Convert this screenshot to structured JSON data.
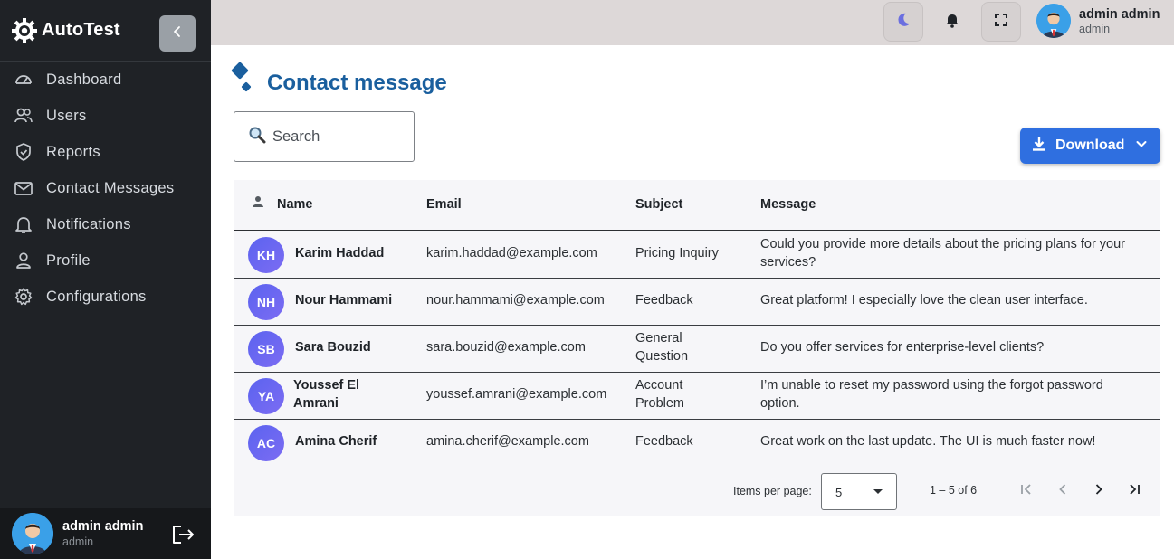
{
  "app": {
    "name": "AutoTest"
  },
  "sidebar": {
    "items": [
      {
        "label": "Dashboard",
        "icon": "dashboard-icon"
      },
      {
        "label": "Users",
        "icon": "users-icon"
      },
      {
        "label": "Reports",
        "icon": "shield-icon"
      },
      {
        "label": "Contact Messages",
        "icon": "mail-icon"
      },
      {
        "label": "Notifications",
        "icon": "bell-icon"
      },
      {
        "label": "Profile",
        "icon": "user-icon"
      },
      {
        "label": "Configurations",
        "icon": "gear-icon"
      }
    ],
    "user": {
      "name": "admin admin",
      "role": "admin"
    }
  },
  "topbar": {
    "user": {
      "name": "admin admin",
      "role": "admin"
    }
  },
  "page": {
    "title": "Contact message",
    "search_placeholder": "Search",
    "download_label": "Download"
  },
  "table": {
    "columns": [
      "Name",
      "Email",
      "Subject",
      "Message"
    ],
    "rows": [
      {
        "initials": "KH",
        "name": "Karim Haddad",
        "email": "karim.haddad@example.com",
        "subject": "Pricing Inquiry",
        "message": "Could you provide more details about the pricing plans for your services?"
      },
      {
        "initials": "NH",
        "name": "Nour Hammami",
        "email": "nour.hammami@example.com",
        "subject": "Feedback",
        "message": "Great platform! I especially love the clean user interface."
      },
      {
        "initials": "SB",
        "name": "Sara Bouzid",
        "email": "sara.bouzid@example.com",
        "subject": "General Question",
        "message": "Do you offer services for enterprise-level clients?"
      },
      {
        "initials": "YA",
        "name": "Youssef El Amrani",
        "email": "youssef.amrani@example.com",
        "subject": "Account Problem",
        "message": "I’m unable to reset my password using the forgot password option."
      },
      {
        "initials": "AC",
        "name": "Amina Cherif",
        "email": "amina.cherif@example.com",
        "subject": "Feedback",
        "message": "Great work on the last update. The UI is much faster now!"
      }
    ]
  },
  "paginator": {
    "items_per_page_label": "Items per page:",
    "items_per_page_value": "5",
    "range_label": "1 – 5 of 6"
  },
  "colors": {
    "accent": "#2f6fe0",
    "title": "#1a5f9e",
    "sidebar_bg": "#1f2226",
    "avatar_gradient_start": "#5b63f0"
  }
}
